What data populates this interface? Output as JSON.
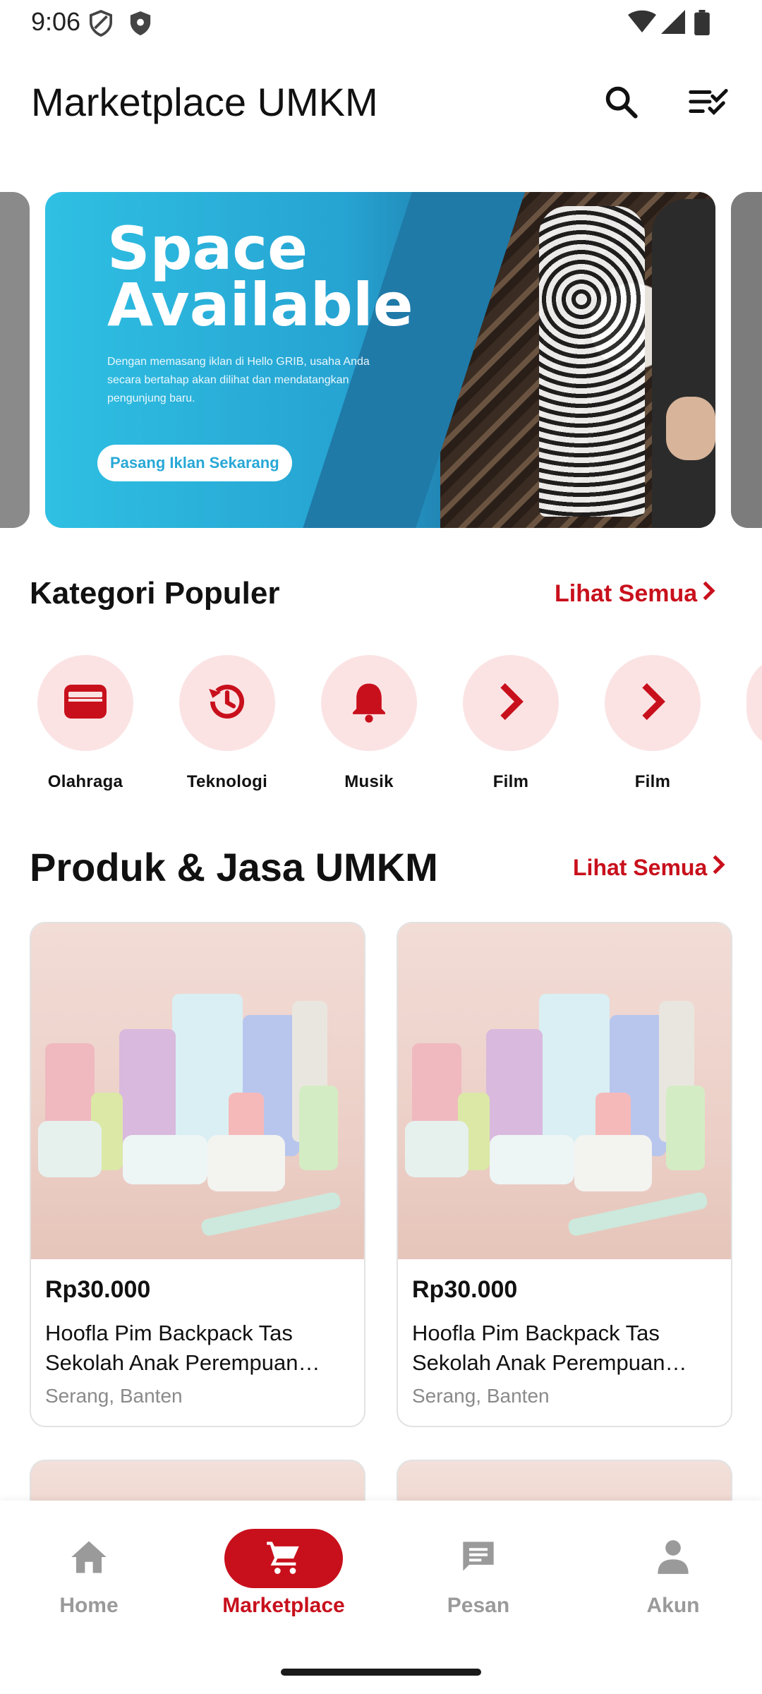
{
  "status_bar": {
    "time": "9:06"
  },
  "app_bar": {
    "title": "Marketplace UMKM",
    "search_icon": "search-icon",
    "filter_icon": "checklist-icon"
  },
  "banner": {
    "headline_line1": "Space",
    "headline_line2": "Available",
    "description": "Dengan memasang iklan di Hello GRIB, usaha Anda secara bertahap akan dilihat dan mendatangkan pengunjung baru.",
    "cta_label": "Pasang Iklan Sekarang"
  },
  "categories_section": {
    "title": "Kategori Populer",
    "see_all": "Lihat Semua",
    "items": [
      {
        "label": "Olahraga",
        "icon": "wallet-icon"
      },
      {
        "label": "Teknologi",
        "icon": "history-icon"
      },
      {
        "label": "Musik",
        "icon": "bell-icon"
      },
      {
        "label": "Film",
        "icon": "chevron-right-icon"
      },
      {
        "label": "Film",
        "icon": "chevron-right-icon"
      }
    ]
  },
  "products_section": {
    "title": "Produk & Jasa UMKM",
    "see_all": "Lihat Semua",
    "items": [
      {
        "price": "Rp30.000",
        "name": "Hoofla Pim Backpack Tas Sekolah Anak Perempuan Remaja",
        "location": "Serang, Banten"
      },
      {
        "price": "Rp30.000",
        "name": "Hoofla Pim Backpack Tas Sekolah Anak Perempuan Remaja",
        "location": "Serang, Banten"
      }
    ]
  },
  "bottom_nav": {
    "items": [
      {
        "label": "Home",
        "icon": "home-icon",
        "active": false
      },
      {
        "label": "Marketplace",
        "icon": "cart-icon",
        "active": true
      },
      {
        "label": "Pesan",
        "icon": "message-icon",
        "active": false
      },
      {
        "label": "Akun",
        "icon": "person-icon",
        "active": false
      }
    ]
  },
  "colors": {
    "accent": "#c8101c",
    "accent_light": "#fbe3e4",
    "banner_blue": "#2fb4de"
  }
}
